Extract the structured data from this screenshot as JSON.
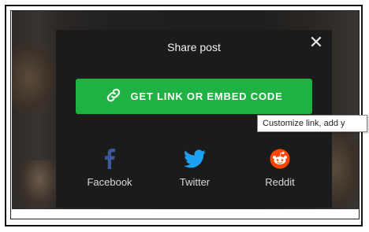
{
  "dialog": {
    "title": "Share post",
    "close_icon": "close-icon",
    "primary_button_label": "GET LINK OR EMBED CODE",
    "primary_button_icon": "link-icon",
    "primary_color": "#1fb141"
  },
  "social": [
    {
      "label": "Facebook",
      "icon": "facebook-icon",
      "color": "#3b5998"
    },
    {
      "label": "Twitter",
      "icon": "twitter-icon",
      "color": "#1da1f2"
    },
    {
      "label": "Reddit",
      "icon": "reddit-icon",
      "color": "#ff4500"
    }
  ],
  "tooltip": {
    "text": "Customize link, add y"
  }
}
